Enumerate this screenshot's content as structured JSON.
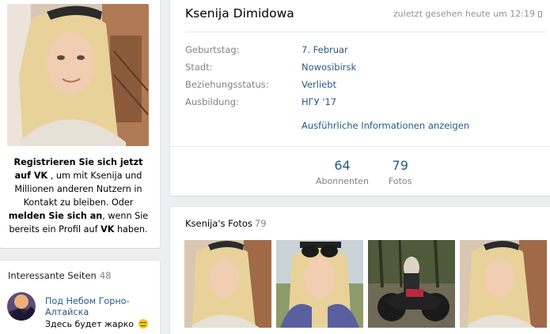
{
  "left": {
    "register": {
      "bold1": "Registrieren Sie sich jetzt auf VK",
      "text1": " , um mit Ksenija und Millionen anderen Nutzern in Kontakt zu bleiben. Oder ",
      "bold2": "melden Sie sich an",
      "text2": ", wenn Sie bereits ein Profil auf ",
      "bold3": "VK",
      "text3": " haben."
    },
    "pages": {
      "title": "Interessante Seiten",
      "count": "48",
      "items": [
        {
          "name": "Под Небом Горно-Алтайска",
          "status": "Здесь будет жарко"
        }
      ]
    }
  },
  "profile": {
    "name": "Ksenija Dimidowa",
    "last_seen": "zuletzt gesehen heute um 12:19",
    "info": [
      {
        "label": "Geburtstag:",
        "value": "7. Februar"
      },
      {
        "label": "Stadt:",
        "value": "Nowosibirsk"
      },
      {
        "label": "Beziehungsstatus:",
        "value": "Verliebt"
      },
      {
        "label": "Ausbildung:",
        "value": "НГУ '17"
      }
    ],
    "more_link": "Ausführliche Informationen anzeigen",
    "counters": [
      {
        "value": "64",
        "label": "Abonnenten"
      },
      {
        "value": "79",
        "label": "Fotos"
      }
    ]
  },
  "photos": {
    "title": "Ksenija's Fotos",
    "count": "79"
  },
  "colors": {
    "link": "#2a5885",
    "muted": "#828282",
    "background": "#edeef0"
  },
  "icons": [
    "phone-icon",
    "emoji-icon"
  ]
}
